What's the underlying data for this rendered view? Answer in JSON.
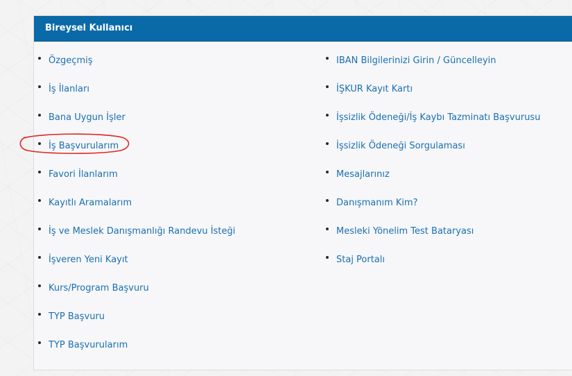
{
  "panel": {
    "title": "Bireysel Kullanıcı"
  },
  "left_links": [
    {
      "label": "Özgeçmiş"
    },
    {
      "label": "İş İlanları"
    },
    {
      "label": "Bana Uygun İşler"
    },
    {
      "label": "İş Başvurularım"
    },
    {
      "label": "Favori İlanlarım"
    },
    {
      "label": "Kayıtlı Aramalarım"
    },
    {
      "label": "İş ve Meslek Danışmanlığı Randevu İsteği"
    },
    {
      "label": "İşveren Yeni Kayıt"
    },
    {
      "label": "Kurs/Program Başvuru"
    },
    {
      "label": "TYP Başvuru"
    },
    {
      "label": "TYP Başvurularım"
    }
  ],
  "right_links": [
    {
      "label": "IBAN Bilgilerinizi Girin / Güncelleyin"
    },
    {
      "label": "İŞKUR Kayıt Kartı"
    },
    {
      "label": "İşsizlik Ödeneği/İş Kaybı Tazminatı Başvurusu"
    },
    {
      "label": "İşsizlik Ödeneği Sorgulaması"
    },
    {
      "label": "Mesajlarınız"
    },
    {
      "label": "Danışmanım Kim?"
    },
    {
      "label": "Mesleki Yönelim Test Bataryası"
    },
    {
      "label": "Staj Portalı"
    }
  ],
  "colors": {
    "header": "#0a6aa8",
    "link": "#1a6fb0",
    "annotation": "#e0241f"
  }
}
